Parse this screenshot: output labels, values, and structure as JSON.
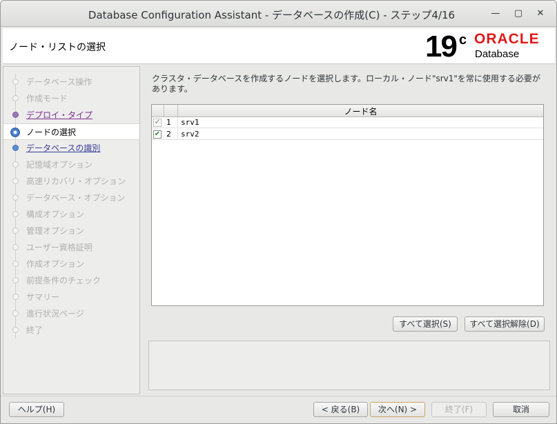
{
  "window": {
    "title": "Database Configuration Assistant - データベースの作成(C) - ステップ4/16",
    "minimize_icon": "minimize-icon",
    "maximize_icon": "maximize-icon",
    "close_icon": "close-icon"
  },
  "header": {
    "page_title": "ノード・リストの選択",
    "logo_version": "19",
    "logo_c": "c",
    "logo_brand": "ORACLE",
    "logo_product": "Database"
  },
  "sidebar": {
    "steps": [
      {
        "label": "データベース操作",
        "state": "done"
      },
      {
        "label": "作成モード",
        "state": "done"
      },
      {
        "label": "デプロイ・タイプ",
        "state": "visited"
      },
      {
        "label": "ノードの選択",
        "state": "current"
      },
      {
        "label": "データベースの識別",
        "state": "link"
      },
      {
        "label": "記憶域オプション",
        "state": "disabled"
      },
      {
        "label": "高速リカバリ・オプション",
        "state": "disabled"
      },
      {
        "label": "データベース・オプション",
        "state": "disabled"
      },
      {
        "label": "構成オプション",
        "state": "disabled"
      },
      {
        "label": "管理オプション",
        "state": "disabled"
      },
      {
        "label": "ユーザー資格証明",
        "state": "disabled"
      },
      {
        "label": "作成オプション",
        "state": "disabled"
      },
      {
        "label": "前提条件のチェック",
        "state": "disabled"
      },
      {
        "label": "サマリー",
        "state": "disabled"
      },
      {
        "label": "進行状況ページ",
        "state": "disabled"
      },
      {
        "label": "終了",
        "state": "disabled"
      }
    ]
  },
  "main": {
    "description": "クラスタ・データベースを作成するノードを選択します。ローカル・ノード\"srv1\"を常に使用する必要があります。",
    "table": {
      "header_name": "ノード名",
      "rows": [
        {
          "num": "1",
          "name": "srv1",
          "checked": true,
          "disabled": true
        },
        {
          "num": "2",
          "name": "srv2",
          "checked": true,
          "disabled": false
        }
      ]
    },
    "select_all_label": "すべて選択(S)",
    "deselect_all_label": "すべて選択解除(D)"
  },
  "footer": {
    "help_label": "ヘルプ(H)",
    "back_label": "< 戻る(B)",
    "next_label": "次へ(N) >",
    "finish_label": "終了(F)",
    "cancel_label": "取消"
  },
  "colors": {
    "oracle_red": "#e01a1a",
    "link_blue": "#3b3b9b",
    "visited_purple": "#7b2e8e"
  }
}
